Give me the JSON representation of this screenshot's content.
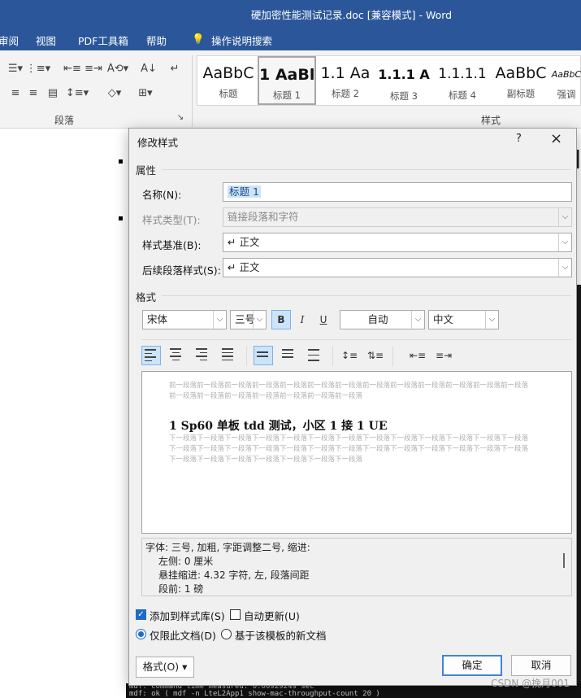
{
  "window": {
    "title": "硬加密性能测试记录.doc [兼容模式]  -  Word"
  },
  "menu": [
    "审阅",
    "视图",
    "PDF工具箱",
    "帮助",
    "操作说明搜索"
  ],
  "ribbon": {
    "paragraph_group": "段落",
    "styles_group": "样式",
    "styles": [
      {
        "sample": "AaBbC",
        "label": "标题"
      },
      {
        "sample": "1  AaBl",
        "label": "标题 1"
      },
      {
        "sample": "1.1   Aa",
        "label": "标题 2"
      },
      {
        "sample": "1.1.1  A",
        "label": "标题 3"
      },
      {
        "sample": "1.1.1.1",
        "label": "标题 4"
      },
      {
        "sample": "AaBbC",
        "label": "副标题"
      },
      {
        "sample": "AaBbC",
        "label": "强调"
      }
    ]
  },
  "dialog": {
    "title": "修改样式",
    "help": "?",
    "close": "×",
    "properties": {
      "heading": "属性",
      "name_label": "名称(N):",
      "name_value": "标题 1",
      "type_label": "样式类型(T):",
      "type_value": "链接段落和字符",
      "based_on_label": "样式基准(B):",
      "based_on_value": "↵ 正文",
      "next_label": "后续段落样式(S):",
      "next_value": "↵ 正文"
    },
    "format": {
      "heading": "格式",
      "font": "宋体",
      "size": "三号",
      "bold": "B",
      "italic": "I",
      "underline": "U",
      "color": "自动",
      "script": "中文"
    },
    "preview": {
      "prev_para": "前一段落前一段落前一段落前一段落前一段落前一段落前一段落前一段落前一段落前一段落前一段落前一段落前一段落前一段落前一段落前一段落前一段落前一段落前一段落前一段落",
      "sample": "1   Sp60 单板 tdd 测试，小区 1 接 1 UE",
      "next_para": "下一段落下一段落下一段落下一段落下一段落下一段落下一段落下一段落下一段落下一段落下一段落下一段落下一段落下一段落下一段落下一段落下一段落下一段落下一段落下一段落下一段落下一段落下一段落下一段落下一段落下一段落下一段落下一段落下一段落下一段落下一段落下一段落下一段落"
    },
    "description": {
      "line1": "字体: 三号, 加粗, 字距调整二号, 缩进:",
      "line2": "左侧:  0 厘米",
      "line3": "悬挂缩进: 4.32 字符, 左, 段落间距",
      "line4": "段前: 1 磅"
    },
    "options": {
      "add_to_gallery": "添加到样式库(S)",
      "add_to_gallery_checked": true,
      "auto_update": "自动更新(U)",
      "auto_update_checked": false,
      "only_this_doc": "仅限此文档(D)",
      "new_docs_template": "基于该模板的新文档"
    },
    "buttons": {
      "format": "格式(O) ▾",
      "ok": "确定",
      "cancel": "取消"
    }
  },
  "terminal": {
    "line1": "mdf: command time measured: 0.0092924s sec",
    "line2": "mdf: ok ( mdf -n LteL2App1 show-mac-throughput-count 20 )"
  },
  "watermark": "CSDN @挽月001"
}
